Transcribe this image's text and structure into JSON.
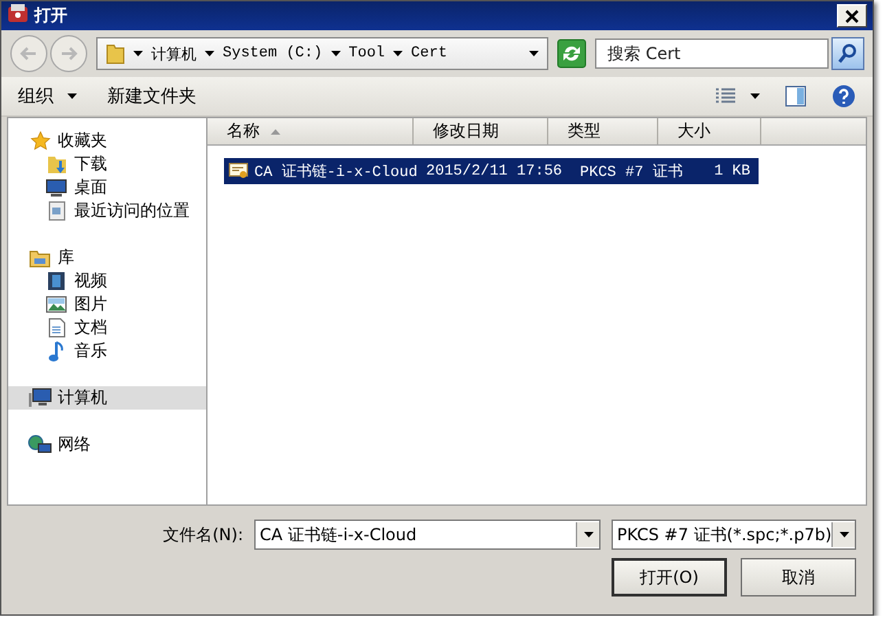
{
  "window": {
    "title": "打开"
  },
  "address": {
    "segments": [
      "计算机",
      "System (C:)",
      "Tool",
      "Cert"
    ]
  },
  "search": {
    "placeholder": "搜索 Cert"
  },
  "toolbar": [
    "组织",
    "新建文件夹"
  ],
  "sidebar": [
    {
      "label": "收藏夹",
      "selected": false,
      "children": [
        {
          "label": "下载",
          "selected": false
        },
        {
          "label": "桌面",
          "selected": false
        },
        {
          "label": "最近访问的位置",
          "selected": false
        }
      ]
    },
    {
      "label": "库",
      "selected": false,
      "children": [
        {
          "label": "视频",
          "selected": false
        },
        {
          "label": "图片",
          "selected": false
        },
        {
          "label": "文档",
          "selected": false
        },
        {
          "label": "音乐",
          "selected": false
        }
      ]
    },
    {
      "label": "计算机",
      "selected": true
    },
    {
      "label": "网络",
      "selected": false
    }
  ],
  "columns": [
    {
      "label": "名称",
      "sorted": true
    },
    {
      "label": "修改日期",
      "sorted": false
    },
    {
      "label": "类型",
      "sorted": false
    },
    {
      "label": "大小",
      "sorted": false
    }
  ],
  "rows": [
    {
      "cells": [
        "CA 证书链-i-x-Cloud",
        "2015/2/11 17:56",
        "PKCS #7 证书",
        "1 KB"
      ],
      "selected": true
    }
  ],
  "filename": {
    "label": "文件名(N):",
    "value": "CA 证书链-i-x-Cloud"
  },
  "filetype": {
    "value": "PKCS #7 证书(*.spc;*.p7b)"
  },
  "buttons": [
    "打开(O)",
    "取消"
  ]
}
